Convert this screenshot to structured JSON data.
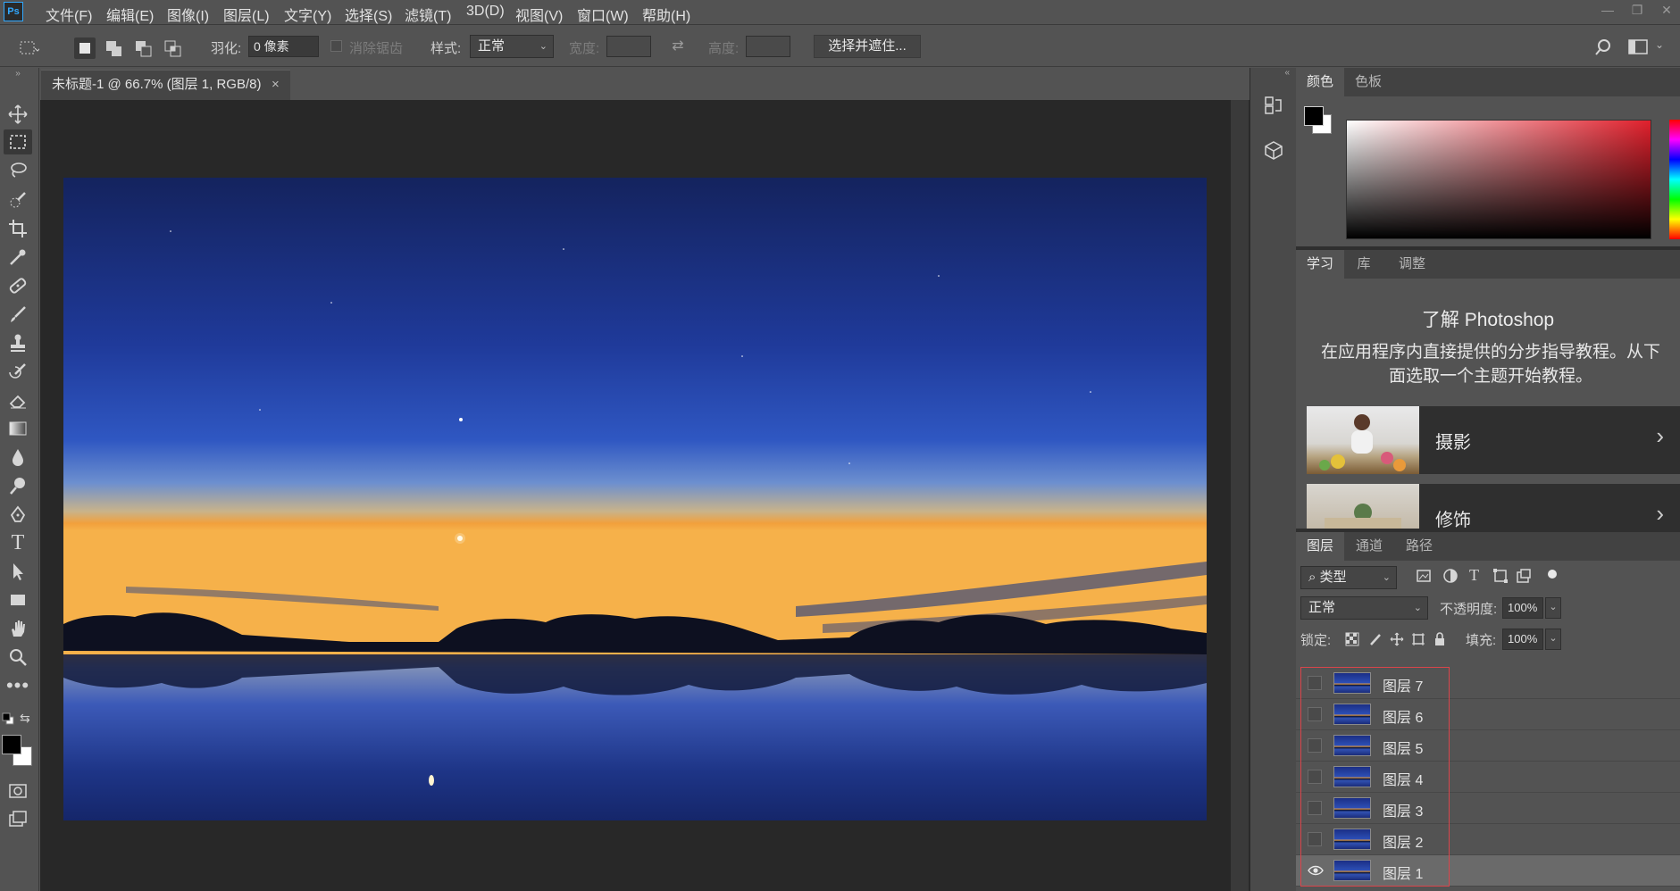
{
  "app": {
    "logo": "Ps"
  },
  "menu": [
    "文件(F)",
    "编辑(E)",
    "图像(I)",
    "图层(L)",
    "文字(Y)",
    "选择(S)",
    "滤镜(T)",
    "3D(D)",
    "视图(V)",
    "窗口(W)",
    "帮助(H)"
  ],
  "options": {
    "feather_label": "羽化:",
    "feather_value": "0 像素",
    "antialias_label": "消除锯齿",
    "style_label": "样式:",
    "style_value": "正常",
    "width_label": "宽度:",
    "height_label": "高度:",
    "select_mask_button": "选择并遮住..."
  },
  "document": {
    "tab_title": "未标题-1 @ 66.7% (图层 1, RGB/8)",
    "close": "×"
  },
  "color_panel": {
    "tabs": [
      "颜色",
      "色板"
    ],
    "active_tab": 0,
    "foreground": "#000000",
    "background": "#ffffff",
    "hue": "#e0202c"
  },
  "learn_panel": {
    "tabs": [
      "学习",
      "库",
      "调整"
    ],
    "active_tab": 0,
    "title": "了解 Photoshop",
    "description": "在应用程序内直接提供的分步指导教程。从下面选取一个主题开始教程。",
    "cards": [
      {
        "title": "摄影"
      },
      {
        "title": "修饰"
      }
    ]
  },
  "layers_panel": {
    "tabs": [
      "图层",
      "通道",
      "路径"
    ],
    "active_tab": 0,
    "filter_value": "类型",
    "blend_mode": "正常",
    "opacity_label": "不透明度:",
    "opacity_value": "100%",
    "lock_label": "锁定:",
    "fill_label": "填充:",
    "fill_value": "100%",
    "layers": [
      {
        "name": "图层 7",
        "visible": false,
        "selected": false
      },
      {
        "name": "图层 6",
        "visible": false,
        "selected": false
      },
      {
        "name": "图层 5",
        "visible": false,
        "selected": false
      },
      {
        "name": "图层 4",
        "visible": false,
        "selected": false
      },
      {
        "name": "图层 3",
        "visible": false,
        "selected": false
      },
      {
        "name": "图层 2",
        "visible": false,
        "selected": false
      },
      {
        "name": "图层 1",
        "visible": true,
        "selected": true
      }
    ],
    "highlight_color": "#d9454b"
  }
}
